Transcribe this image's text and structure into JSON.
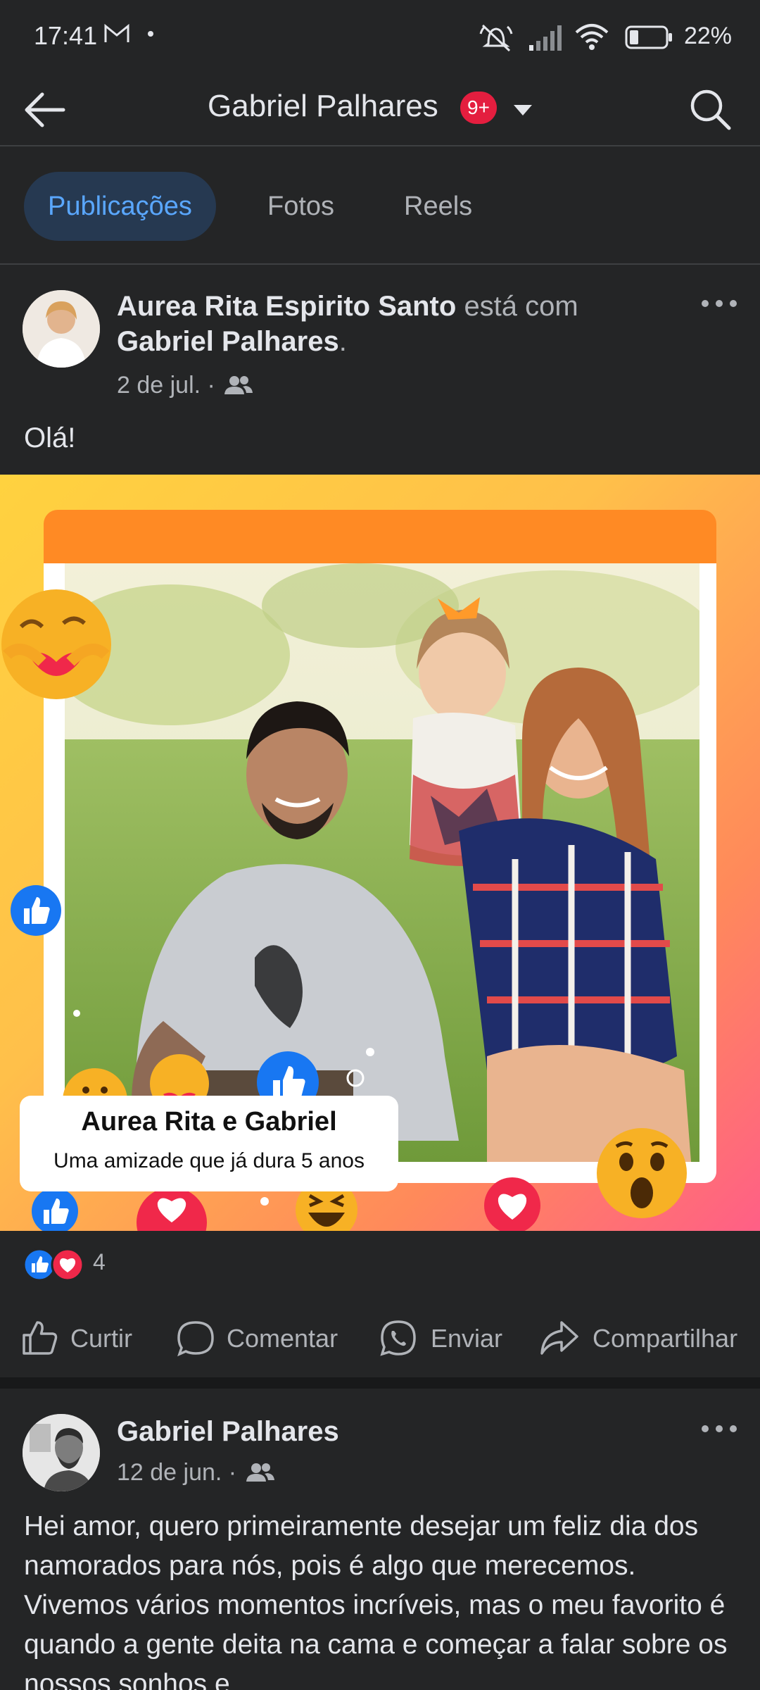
{
  "status_bar": {
    "time": "17:41",
    "battery": "22%"
  },
  "header": {
    "title": "Gabriel Palhares",
    "badge": "9+"
  },
  "tabs": [
    {
      "label": "Publicações",
      "active": true
    },
    {
      "label": "Fotos",
      "active": false
    },
    {
      "label": "Reels",
      "active": false
    }
  ],
  "post1": {
    "author": "Aurea Rita Espirito Santo",
    "with_text": "está com",
    "tagged": "Gabriel Palhares",
    "period": ".",
    "date": "2 de jul. ·",
    "text": "Olá!",
    "media_caption_title": "Aurea Rita e Gabriel",
    "media_caption_subtitle": "Uma amizade que já dura 5 anos",
    "reaction_count": "4",
    "actions": [
      "Curtir",
      "Comentar",
      "Enviar",
      "Compartilhar"
    ]
  },
  "post2": {
    "author": "Gabriel Palhares",
    "date": "12 de jun. ·",
    "text": "Hei amor, quero primeiramente desejar um feliz dia dos namorados para nós, pois é algo que merecemos. Vivemos vários momentos incríveis, mas o meu favorito é quando a gente deita na cama e começar a falar sobre os nossos sonhos e"
  },
  "colors": {
    "background": "#242526",
    "active_tab_bg": "#263951",
    "active_tab_text": "#5aa7ff",
    "badge": "#e41e3f",
    "like_blue": "#1877f2",
    "love_red": "#f0284a"
  },
  "icons": [
    "back-arrow-icon",
    "caret-down-icon",
    "search-icon",
    "friends-icon",
    "more-icon",
    "like-icon",
    "comment-icon",
    "whatsapp-icon",
    "share-icon"
  ]
}
